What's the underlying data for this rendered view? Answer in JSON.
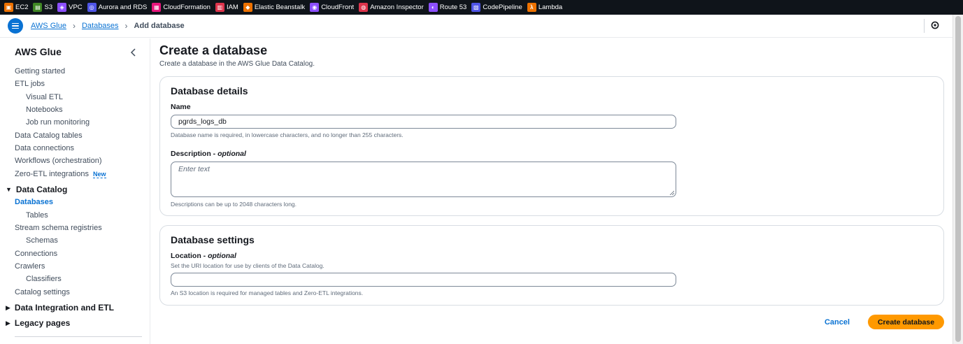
{
  "services": [
    {
      "label": "EC2",
      "icon": "ec2-icon",
      "color": "#ed7100"
    },
    {
      "label": "S3",
      "icon": "s3-icon",
      "color": "#3f8624"
    },
    {
      "label": "VPC",
      "icon": "vpc-icon",
      "color": "#8c4fff"
    },
    {
      "label": "Aurora and RDS",
      "icon": "rds-icon",
      "color": "#4f55e6"
    },
    {
      "label": "CloudFormation",
      "icon": "cloudformation-icon",
      "color": "#e7157b"
    },
    {
      "label": "IAM",
      "icon": "iam-icon",
      "color": "#dd344c"
    },
    {
      "label": "Elastic Beanstalk",
      "icon": "beanstalk-icon",
      "color": "#ed7100"
    },
    {
      "label": "CloudFront",
      "icon": "cloudfront-icon",
      "color": "#8c4fff"
    },
    {
      "label": "Amazon Inspector",
      "icon": "inspector-icon",
      "color": "#dd344c"
    },
    {
      "label": "Route 53",
      "icon": "route53-icon",
      "color": "#8c4fff"
    },
    {
      "label": "CodePipeline",
      "icon": "codepipeline-icon",
      "color": "#4f55e6"
    },
    {
      "label": "Lambda",
      "icon": "lambda-icon",
      "color": "#ed7100"
    }
  ],
  "breadcrumb": {
    "items": [
      "AWS Glue",
      "Databases"
    ],
    "current": "Add database"
  },
  "sidebar": {
    "title": "AWS Glue",
    "items": [
      {
        "label": "Getting started"
      },
      {
        "label": "ETL jobs"
      },
      {
        "label": "Visual ETL"
      },
      {
        "label": "Notebooks"
      },
      {
        "label": "Job run monitoring"
      },
      {
        "label": "Data Catalog tables"
      },
      {
        "label": "Data connections"
      },
      {
        "label": "Workflows (orchestration)"
      },
      {
        "label": "Zero-ETL integrations",
        "badge": "New"
      }
    ],
    "data_catalog": {
      "title": "Data Catalog",
      "items": [
        "Databases",
        "Tables",
        "Stream schema registries",
        "Schemas",
        "Connections",
        "Crawlers",
        "Classifiers",
        "Catalog settings"
      ]
    },
    "sections": [
      "Data Integration and ETL",
      "Legacy pages"
    ]
  },
  "page": {
    "title": "Create a database",
    "description": "Create a database in the AWS Glue Data Catalog."
  },
  "details": {
    "heading": "Database details",
    "name_label": "Name",
    "name_value": "pgrds_logs_db",
    "name_hint": "Database name is required, in lowercase characters, and no longer than 255 characters.",
    "desc_label": "Description",
    "desc_optional": "optional",
    "desc_placeholder": "Enter text",
    "desc_hint": "Descriptions can be up to 2048 characters long."
  },
  "settings": {
    "heading": "Database settings",
    "location_label": "Location",
    "location_optional": "optional",
    "location_desc": "Set the URI location for use by clients of the Data Catalog.",
    "location_value": "",
    "location_hint": "An S3 location is required for managed tables and Zero-ETL integrations."
  },
  "actions": {
    "cancel": "Cancel",
    "create": "Create database"
  }
}
